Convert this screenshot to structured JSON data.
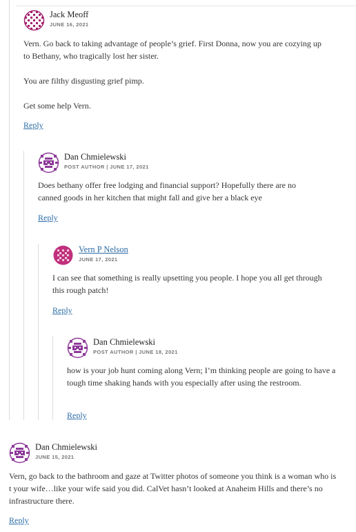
{
  "comments": [
    {
      "author": "Jack Meoff",
      "meta": "JUNE 16, 2021",
      "paragraphs": [
        "Vern. Go back to taking advantage of people’s grief. First Donna, now you are cozying up to Bethany, who tragically lost her sister.",
        "You are filthy disgusting grief pimp.",
        "Get some help Vern."
      ],
      "reply": "Reply"
    },
    {
      "author": "Dan Chmielewski",
      "meta": "POST AUTHOR | JUNE 17, 2021",
      "paragraphs": [
        "Does bethany offer free lodging and financial support? Hopefully there are no canned goods in her kitchen that might fall and give her a black eye"
      ],
      "reply": "Reply"
    },
    {
      "author": "Vern P Nelson",
      "meta": "JUNE 17, 2021",
      "paragraphs": [
        "I can see that something is really upsetting you people. I hope you all get through this rough patch!"
      ],
      "reply": "Reply"
    },
    {
      "author": "Dan Chmielewski",
      "meta": "POST AUTHOR | JUNE 18, 2021",
      "paragraphs": [
        "how is your job hunt coming along Vern; I’m thinking people are going to have a tough time shaking hands with you especially after using the restroom."
      ],
      "reply": "Reply"
    },
    {
      "author": "Dan Chmielewski",
      "meta": "JUNE 15, 2021",
      "paragraphs": [
        "Vern, go back to the bathroom and gaze at Twitter photos of someone you think is a woman who is t your wife…like your wife said you did. CalVet hasn’t looked at Anaheim Hills and there’s no infrastructure there."
      ],
      "reply": "Reply"
    }
  ],
  "colors": {
    "avatar": "#a4206d",
    "link": "#2b6aa6",
    "thread_line": "#dcdcdc"
  },
  "icons": {
    "avatar": "identicon-avatar-icon"
  }
}
